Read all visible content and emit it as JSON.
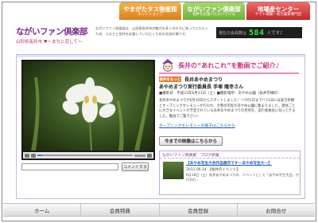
{
  "header": {
    "tabs": [
      {
        "title": "やまがたタス物産館",
        "subtitle": "ネットショップ"
      },
      {
        "title": "ながいファン倶楽部",
        "subtitle": "長井を応援いただいている"
      },
      {
        "title": "地場産センター",
        "subtitle": "ヤマト運輸・地元農家専門店"
      }
    ],
    "logo_main": "ながいファン倶楽部",
    "logo_sub": "山形県長井市 ♥〜まちに恋して〜",
    "intro": "ながいファン倶楽部は、山形県長井市の魅力を多くの方々に知っていただくため、ふるさと長井を応援していただくための交流の場です。",
    "counter_label": "現在の会員数は",
    "counter_value": "584",
    "counter_unit": "人です♪"
  },
  "feature": {
    "heading": "長井の“あれこれ”を動画でご紹介♪",
    "badge": "長井をもっと",
    "guest_line1": "長井あやめまつり",
    "guest_line2": "あやめまつり実行委員長 手塚 隆幸さん",
    "meta": "■撮影日：平成23年6月11日（土）■撮影場所：あやめ公園（長井市横町）",
    "body": "長井あやめまつりが6月10日からスタートしました！〜7月1日まで!! 11日には安全祈願とオープニングセレモニーが行われ、大勢の市民があやめ公園に集まりました。連休ごとに大きなイベントが予定されている長井あやめまつりの見所を、実行委員長に伺ってきました。動画でご覧下さい♪",
    "link_text": "オープニングセレモニーの様子はこちらから",
    "watch_button": "今までの映像はこちらから"
  },
  "video": {
    "progress": 0.05
  },
  "comment": {
    "placeholder": "",
    "button": "コメントする"
  },
  "blog": {
    "header": "ながいファン倶楽部　ブログ新着",
    "title": "【あやめ写生大会作品展示ですーあやめ写生大ー】",
    "date": "2011.06.14 【長井のイベント】",
    "excerpt": "6月18日（土）長井あやめまつりの、イベントとして「あやめ写生大会」が行われ..."
  },
  "nav": [
    "ホーム",
    "会員特典",
    "会員登録",
    "お問合せ"
  ],
  "colors": {
    "accent_pink": "#d02f87",
    "counter_green": "#39e639",
    "nav_bg": "#e6e6e6"
  }
}
